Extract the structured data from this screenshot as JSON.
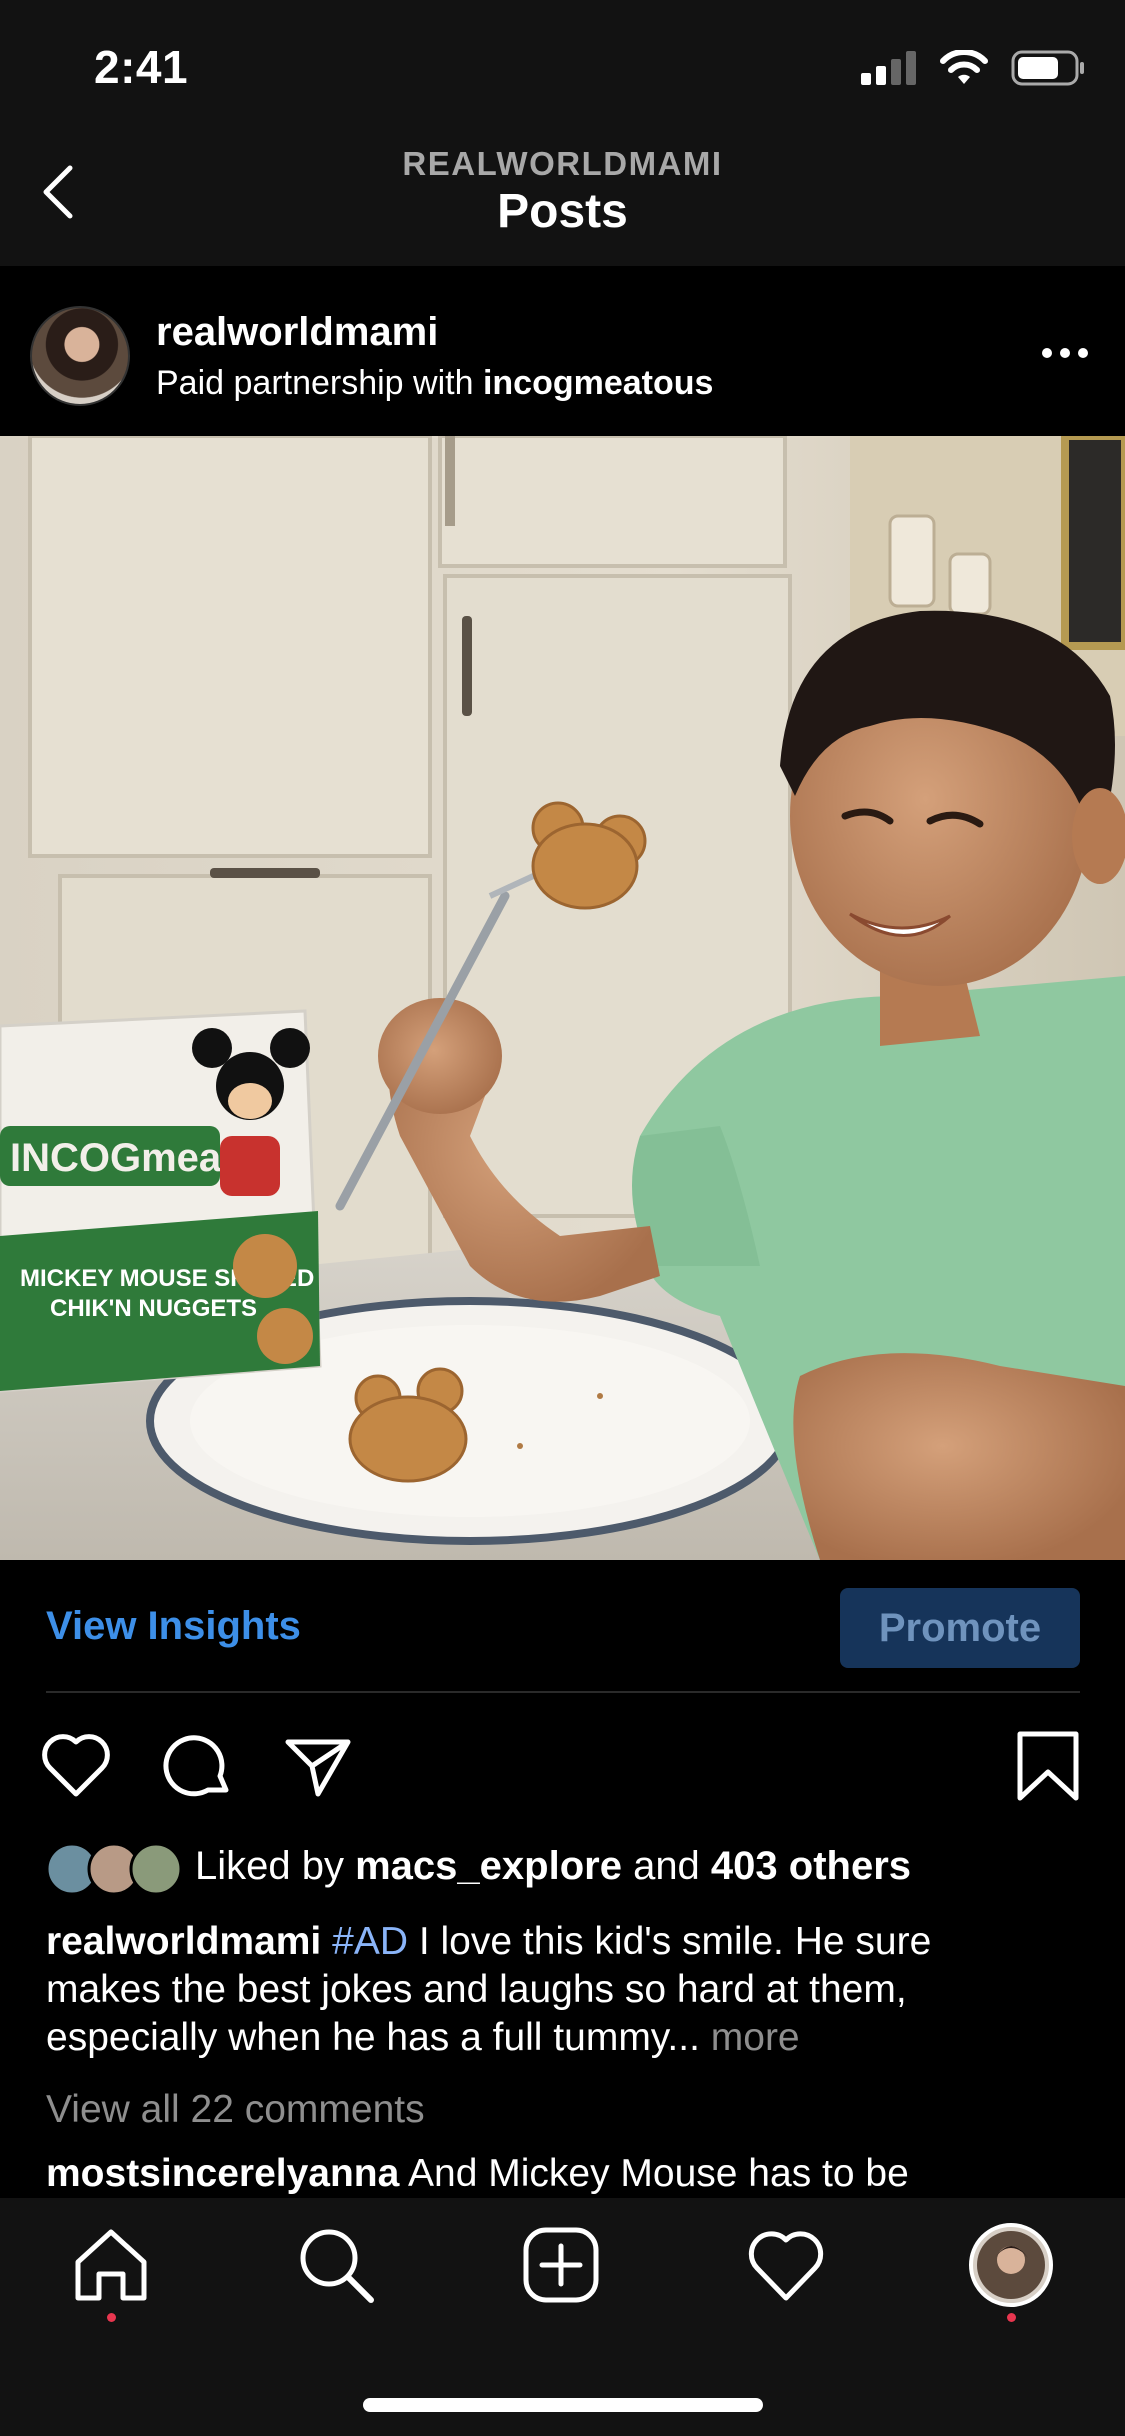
{
  "status_bar": {
    "time": "2:41"
  },
  "nav": {
    "subtitle": "REALWORLDMAMI",
    "title": "Posts"
  },
  "post": {
    "username": "realworldmami",
    "partnership_prefix": "Paid partnership with ",
    "partner": "incogmeatous"
  },
  "insights": {
    "view_label": "View Insights",
    "promote_label": "Promote"
  },
  "likes": {
    "prefix": "Liked by ",
    "user": "macs_explore",
    "middle": " and ",
    "count": "403 others"
  },
  "caption": {
    "username": "realworldmami",
    "hashtag": "#AD",
    "text_line1": " I love this kid's smile. He sure",
    "text_line2": "makes the best jokes and laughs so hard at them,",
    "text_line3": "especially when he has a full tummy... ",
    "more": "more"
  },
  "comments": {
    "view_all": "View all 22 comments",
    "preview_user": "mostsincerelyanna",
    "preview_text": " And Mickey Mouse has to be"
  },
  "colors": {
    "link_blue": "#3d8fe8",
    "promote_bg": "#16345a",
    "notification_dot": "#e8364f"
  },
  "icons": [
    "back-chevron-icon",
    "more-icon",
    "heart-icon",
    "comment-icon",
    "share-icon",
    "bookmark-icon",
    "home-icon",
    "search-icon",
    "add-post-icon",
    "activity-heart-icon",
    "profile-avatar-icon"
  ]
}
